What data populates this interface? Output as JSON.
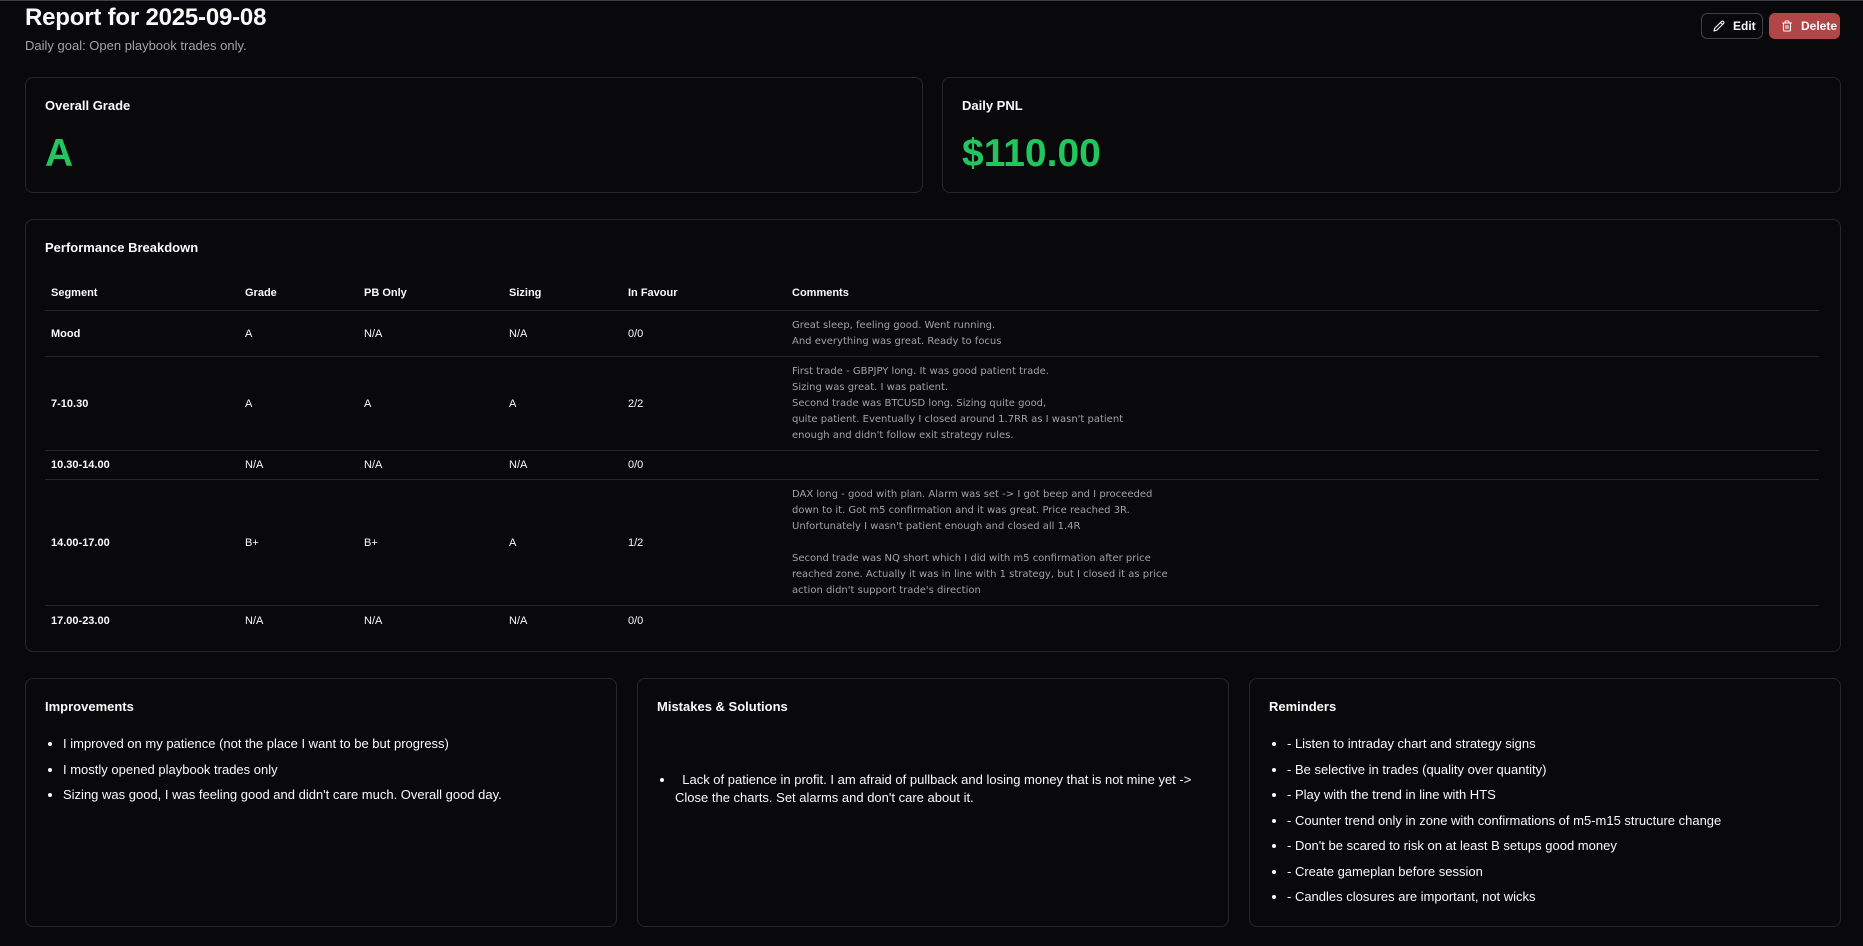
{
  "header": {
    "title": "Report for 2025-09-08",
    "subtitle": "Daily goal: Open playbook trades only.",
    "edit_label": "Edit",
    "delete_label": "Delete"
  },
  "overall_grade": {
    "title": "Overall Grade",
    "value": "A"
  },
  "daily_pnl": {
    "title": "Daily PNL",
    "value": "$110.00"
  },
  "performance": {
    "title": "Performance Breakdown",
    "columns": [
      "Segment",
      "Grade",
      "PB Only",
      "Sizing",
      "In Favour",
      "Comments"
    ],
    "rows": [
      [
        "Mood",
        "A",
        "N/A",
        "N/A",
        "0/0",
        "Great sleep, feeling good. Went running.\nAnd everything was great. Ready to focus"
      ],
      [
        "7-10.30",
        "A",
        "A",
        "A",
        "2/2",
        "First trade - GBPJPY long. It was good patient trade.\nSizing was great. I was patient.\nSecond trade was BTCUSD long. Sizing quite good,\nquite patient. Eventually I closed around 1.7RR as I wasn't patient\nenough and didn't follow exit strategy rules."
      ],
      [
        "10.30-14.00",
        "N/A",
        "N/A",
        "N/A",
        "0/0",
        ""
      ],
      [
        "14.00-17.00",
        "B+",
        "B+",
        "A",
        "1/2",
        "DAX long - good with plan. Alarm was set -> I got beep and I proceeded\ndown to it. Got m5 confirmation and it was great. Price reached 3R.\nUnfortunately I wasn't patient enough and closed all 1.4R\n\nSecond trade was NQ short which I did with m5 confirmation after price\nreached zone. Actually it was in line with 1 strategy, but I closed it as price\naction didn't support trade's direction"
      ],
      [
        "17.00-23.00",
        "N/A",
        "N/A",
        "N/A",
        "0/0",
        ""
      ]
    ]
  },
  "improvements": {
    "title": "Improvements",
    "items": [
      "I improved on my patience (not the place I want to be but progress)",
      "I mostly opened playbook trades only",
      "Sizing was good, I was feeling good and didn't care much. Overall good day."
    ]
  },
  "mistakes": {
    "title": "Mistakes & Solutions",
    "items": [
      "  Lack of patience in profit. I am afraid of pullback and losing money that is not mine yet -> Close the charts. Set alarms and don't care about it."
    ]
  },
  "reminders": {
    "title": "Reminders",
    "items": [
      "- Listen to intraday chart and strategy signs",
      "- Be selective in trades (quality over quantity)",
      "- Play with the trend in line with HTS",
      "- Counter trend only in zone with confirmations of m5-m15 structure change",
      "- Don't be scared to risk on at least B setups good money",
      "- Create gameplan before session",
      "- Candles closures are important, not wicks"
    ]
  },
  "colors": {
    "background": "#09090b",
    "positive": "#22c55e",
    "danger": "#b24548",
    "border": "#27272a"
  }
}
